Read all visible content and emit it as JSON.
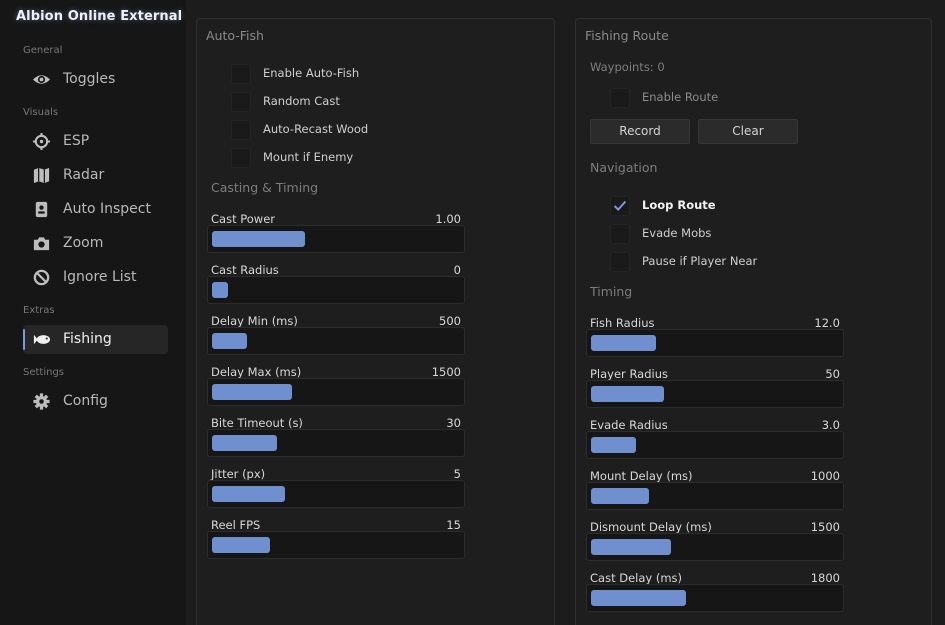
{
  "app": {
    "title": "Albion Online External"
  },
  "sidebar": {
    "sections": {
      "general": "General",
      "visuals": "Visuals",
      "extras": "Extras",
      "settings": "Settings"
    },
    "items": [
      {
        "label": "Toggles",
        "icon": "eye-icon"
      },
      {
        "label": "ESP",
        "icon": "crosshair-icon"
      },
      {
        "label": "Radar",
        "icon": "map-icon"
      },
      {
        "label": "Auto Inspect",
        "icon": "id-badge-icon"
      },
      {
        "label": "Zoom",
        "icon": "camera-icon"
      },
      {
        "label": "Ignore List",
        "icon": "ban-icon"
      },
      {
        "label": "Fishing",
        "icon": "fish-icon",
        "active": true
      },
      {
        "label": "Config",
        "icon": "gear-icon"
      }
    ]
  },
  "autofish": {
    "title": "Auto-Fish",
    "checkboxes": [
      {
        "label": "Enable Auto-Fish",
        "checked": false
      },
      {
        "label": "Random Cast",
        "checked": false
      },
      {
        "label": "Auto-Recast Wood",
        "checked": false
      },
      {
        "label": "Mount if Enemy",
        "checked": false
      }
    ],
    "timing_title": "Casting & Timing",
    "sliders": [
      {
        "label": "Cast Power",
        "value": "1.00",
        "fill": 0.37
      },
      {
        "label": "Cast Radius",
        "value": "0",
        "fill": 0.06
      },
      {
        "label": "Delay Min (ms)",
        "value": "500",
        "fill": 0.14
      },
      {
        "label": "Delay Max (ms)",
        "value": "1500",
        "fill": 0.32
      },
      {
        "label": "Bite Timeout (s)",
        "value": "30",
        "fill": 0.26
      },
      {
        "label": "Jitter (px)",
        "value": "5",
        "fill": 0.29
      },
      {
        "label": "Reel FPS",
        "value": "15",
        "fill": 0.23
      }
    ]
  },
  "route": {
    "title": "Fishing Route",
    "waypoints": "Waypoints: 0",
    "enable_label": "Enable Route",
    "enable_checked": false,
    "record_label": "Record",
    "clear_label": "Clear",
    "nav_title": "Navigation",
    "nav_checkboxes": [
      {
        "label": "Loop Route",
        "checked": true
      },
      {
        "label": "Evade Mobs",
        "checked": false
      },
      {
        "label": "Pause if Player Near",
        "checked": false
      }
    ],
    "timing_title": "Timing",
    "sliders": [
      {
        "label": "Fish Radius",
        "value": "12.0",
        "fill": 0.26
      },
      {
        "label": "Player Radius",
        "value": "50",
        "fill": 0.29
      },
      {
        "label": "Evade Radius",
        "value": "3.0",
        "fill": 0.18
      },
      {
        "label": "Mount Delay (ms)",
        "value": "1000",
        "fill": 0.23
      },
      {
        "label": "Dismount Delay (ms)",
        "value": "1500",
        "fill": 0.32
      },
      {
        "label": "Cast Delay (ms)",
        "value": "1800",
        "fill": 0.38
      }
    ]
  },
  "colors": {
    "accent": "#6f8fcf",
    "bg": "#1c1c1c",
    "sidebar": "#161616"
  }
}
